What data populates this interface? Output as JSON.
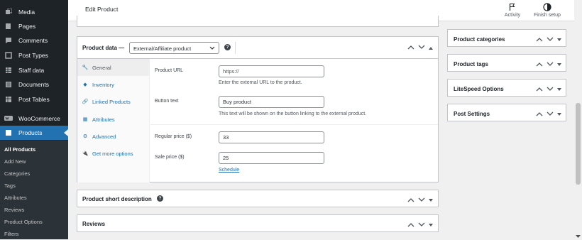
{
  "sidebar": {
    "items": [
      {
        "label": "Media",
        "icon": "media-icon"
      },
      {
        "label": "Pages",
        "icon": "pages-icon"
      },
      {
        "label": "Comments",
        "icon": "comments-icon"
      },
      {
        "label": "Post Types",
        "icon": "post-types-icon"
      },
      {
        "label": "Staff data",
        "icon": "staff-data-icon"
      },
      {
        "label": "Documents",
        "icon": "documents-icon"
      },
      {
        "label": "Post Tables",
        "icon": "post-tables-icon"
      },
      {
        "label": "WooCommerce",
        "icon": "woocommerce-icon"
      },
      {
        "label": "Products",
        "icon": "products-icon"
      }
    ],
    "submenu": [
      "All Products",
      "Add New",
      "Categories",
      "Tags",
      "Attributes",
      "Reviews",
      "Product Options",
      "Filters"
    ]
  },
  "topbar": {
    "title": "Edit Product",
    "activity_label": "Activity",
    "finish_setup_label": "Finish setup"
  },
  "product_data": {
    "title": "Product data —",
    "product_type": "External/Affiliate product",
    "tabs": [
      {
        "label": "General",
        "icon": "wrench-icon"
      },
      {
        "label": "Inventory",
        "icon": "tag-icon"
      },
      {
        "label": "Linked Products",
        "icon": "link-icon"
      },
      {
        "label": "Attributes",
        "icon": "table-icon"
      },
      {
        "label": "Advanced",
        "icon": "gear-icon"
      },
      {
        "label": "Get more options",
        "icon": "plugin-icon"
      }
    ],
    "fields": {
      "product_url_label": "Product URL",
      "product_url_placeholder": "https://",
      "product_url_desc": "Enter the external URL to the product.",
      "button_text_label": "Button text",
      "button_text_value": "Buy product",
      "button_text_desc": "This text will be shown on the button linking to the external product.",
      "regular_price_label": "Regular price ($)",
      "regular_price_value": "33",
      "sale_price_label": "Sale price ($)",
      "sale_price_value": "25",
      "schedule_link": "Schedule"
    }
  },
  "short_description": {
    "title": "Product short description"
  },
  "reviews": {
    "title": "Reviews"
  },
  "side_boxes": [
    {
      "title": "Product categories"
    },
    {
      "title": "Product tags"
    },
    {
      "title": "LiteSpeed Options"
    },
    {
      "title": "Post Settings"
    }
  ],
  "colors": {
    "accent": "#2271b1",
    "sidebar_bg": "#1d2327",
    "page_bg": "#f0f0f1"
  }
}
